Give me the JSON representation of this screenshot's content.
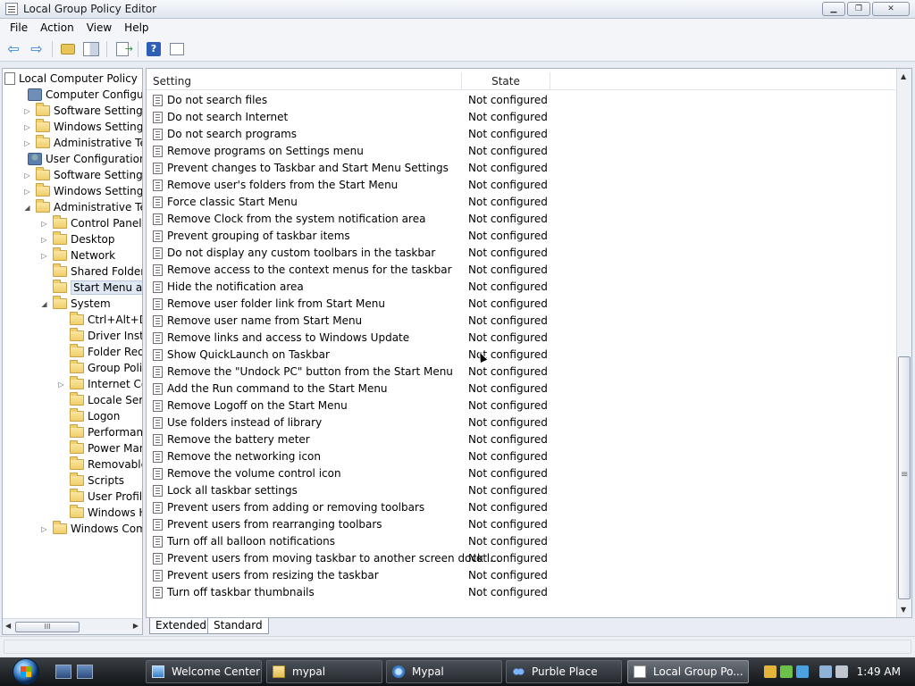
{
  "window": {
    "title": "Local Group Policy Editor",
    "buttons": {
      "minimize": "▁",
      "maximize": "❐",
      "close": "✕"
    }
  },
  "menu": [
    "File",
    "Action",
    "View",
    "Help"
  ],
  "toolbar": {
    "icons": [
      "back-arrow-icon",
      "forward-arrow-icon",
      "up-folder-icon",
      "show-hide-tree-icon",
      "export-list-icon",
      "help-icon",
      "properties-icon"
    ],
    "help_label": "?"
  },
  "tree": {
    "root": "Local Computer Policy",
    "nodes": [
      {
        "label": "Computer Configuratio",
        "level": 1,
        "expander": "",
        "icon": "computer"
      },
      {
        "label": "Software Settings",
        "level": 2,
        "expander": "▷",
        "icon": "folder"
      },
      {
        "label": "Windows Settings",
        "level": 2,
        "expander": "▷",
        "icon": "folder"
      },
      {
        "label": "Administrative Tem",
        "level": 2,
        "expander": "▷",
        "icon": "folder"
      },
      {
        "label": "User Configuration",
        "level": 1,
        "expander": "",
        "icon": "user"
      },
      {
        "label": "Software Settings",
        "level": 2,
        "expander": "▷",
        "icon": "folder"
      },
      {
        "label": "Windows Settings",
        "level": 2,
        "expander": "▷",
        "icon": "folder"
      },
      {
        "label": "Administrative Tem",
        "level": 2,
        "expander": "◢",
        "icon": "folder"
      },
      {
        "label": "Control Panel",
        "level": 3,
        "expander": "▷",
        "icon": "folder"
      },
      {
        "label": "Desktop",
        "level": 3,
        "expander": "▷",
        "icon": "folder"
      },
      {
        "label": "Network",
        "level": 3,
        "expander": "▷",
        "icon": "folder"
      },
      {
        "label": "Shared Folders",
        "level": 3,
        "expander": "",
        "icon": "folder"
      },
      {
        "label": "Start Menu and T",
        "level": 3,
        "expander": "",
        "icon": "folder",
        "selected": true
      },
      {
        "label": "System",
        "level": 3,
        "expander": "◢",
        "icon": "folder"
      },
      {
        "label": "Ctrl+Alt+Del",
        "level": 4,
        "expander": "",
        "icon": "folder"
      },
      {
        "label": "Driver Installa",
        "level": 4,
        "expander": "",
        "icon": "folder"
      },
      {
        "label": "Folder Redire",
        "level": 4,
        "expander": "",
        "icon": "folder"
      },
      {
        "label": "Group Policy",
        "level": 4,
        "expander": "",
        "icon": "folder"
      },
      {
        "label": "Internet Com",
        "level": 4,
        "expander": "▷",
        "icon": "folder"
      },
      {
        "label": "Locale Servic",
        "level": 4,
        "expander": "",
        "icon": "folder"
      },
      {
        "label": "Logon",
        "level": 4,
        "expander": "",
        "icon": "folder"
      },
      {
        "label": "Performance",
        "level": 4,
        "expander": "",
        "icon": "folder"
      },
      {
        "label": "Power Mana",
        "level": 4,
        "expander": "",
        "icon": "folder"
      },
      {
        "label": "Removable S",
        "level": 4,
        "expander": "",
        "icon": "folder"
      },
      {
        "label": "Scripts",
        "level": 4,
        "expander": "",
        "icon": "folder"
      },
      {
        "label": "User Profiles",
        "level": 4,
        "expander": "",
        "icon": "folder"
      },
      {
        "label": "Windows Ho",
        "level": 4,
        "expander": "",
        "icon": "folder"
      },
      {
        "label": "Windows Comp",
        "level": 3,
        "expander": "▷",
        "icon": "folder"
      }
    ],
    "hscroll_grip": "III"
  },
  "details": {
    "columns": {
      "setting": "Setting",
      "state": "State"
    },
    "rows": [
      {
        "name": "Do not search files",
        "state": "Not configured"
      },
      {
        "name": "Do not search Internet",
        "state": "Not configured"
      },
      {
        "name": "Do not search programs",
        "state": "Not configured"
      },
      {
        "name": "Remove programs on Settings menu",
        "state": "Not configured"
      },
      {
        "name": "Prevent changes to Taskbar and Start Menu Settings",
        "state": "Not configured"
      },
      {
        "name": "Remove user's folders from the Start Menu",
        "state": "Not configured"
      },
      {
        "name": "Force classic Start Menu",
        "state": "Not configured"
      },
      {
        "name": "Remove Clock from the system notification area",
        "state": "Not configured"
      },
      {
        "name": "Prevent grouping of taskbar items",
        "state": "Not configured"
      },
      {
        "name": "Do not display any custom toolbars in the taskbar",
        "state": "Not configured"
      },
      {
        "name": "Remove access to the context menus for the taskbar",
        "state": "Not configured"
      },
      {
        "name": "Hide the notification area",
        "state": "Not configured"
      },
      {
        "name": "Remove user folder link from Start Menu",
        "state": "Not configured"
      },
      {
        "name": "Remove user name from Start Menu",
        "state": "Not configured"
      },
      {
        "name": "Remove links and access to Windows Update",
        "state": "Not configured"
      },
      {
        "name": "Show QuickLaunch on Taskbar",
        "state": "Not configured"
      },
      {
        "name": "Remove the \"Undock PC\" button from the Start Menu",
        "state": "Not configured"
      },
      {
        "name": "Add the Run command to the Start Menu",
        "state": "Not configured"
      },
      {
        "name": "Remove Logoff on the Start Menu",
        "state": "Not configured"
      },
      {
        "name": "Use folders instead of library",
        "state": "Not configured"
      },
      {
        "name": "Remove the battery meter",
        "state": "Not configured"
      },
      {
        "name": "Remove the networking icon",
        "state": "Not configured"
      },
      {
        "name": "Remove the volume control icon",
        "state": "Not configured"
      },
      {
        "name": "Lock all taskbar settings",
        "state": "Not configured"
      },
      {
        "name": "Prevent users from adding or removing toolbars",
        "state": "Not configured"
      },
      {
        "name": "Prevent users from rearranging toolbars",
        "state": "Not configured"
      },
      {
        "name": "Turn off all balloon notifications",
        "state": "Not configured"
      },
      {
        "name": "Prevent users from moving taskbar to another screen dock l...",
        "state": "Not configured"
      },
      {
        "name": "Prevent users from resizing the taskbar",
        "state": "Not configured"
      },
      {
        "name": "Turn off taskbar thumbnails",
        "state": "Not configured"
      }
    ]
  },
  "tabs": [
    "Extended",
    "Standard"
  ],
  "taskbar": {
    "tasks": [
      {
        "label": "Welcome Center",
        "icon": "wc"
      },
      {
        "label": "mypal",
        "icon": "folder"
      },
      {
        "label": "Mypal",
        "icon": "net"
      },
      {
        "label": "Purble Place",
        "icon": "purble"
      },
      {
        "label": "Local Group Po...",
        "icon": "gp",
        "active": true
      }
    ],
    "clock": "1:49 AM"
  }
}
